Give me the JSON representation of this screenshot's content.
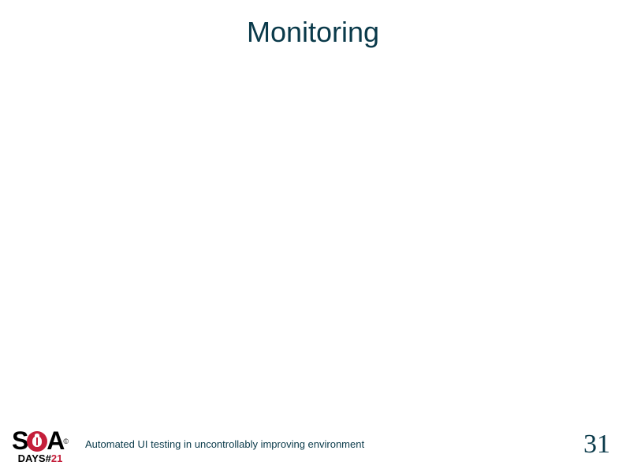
{
  "title": "Monitoring",
  "footer": {
    "text": "Automated UI testing in uncontrollably improving environment",
    "page_number": "31"
  },
  "logo": {
    "letter_s": "S",
    "letter_a": "A",
    "trademark": "©",
    "days_prefix": "DAYS",
    "hash": "#",
    "edition": "21"
  }
}
